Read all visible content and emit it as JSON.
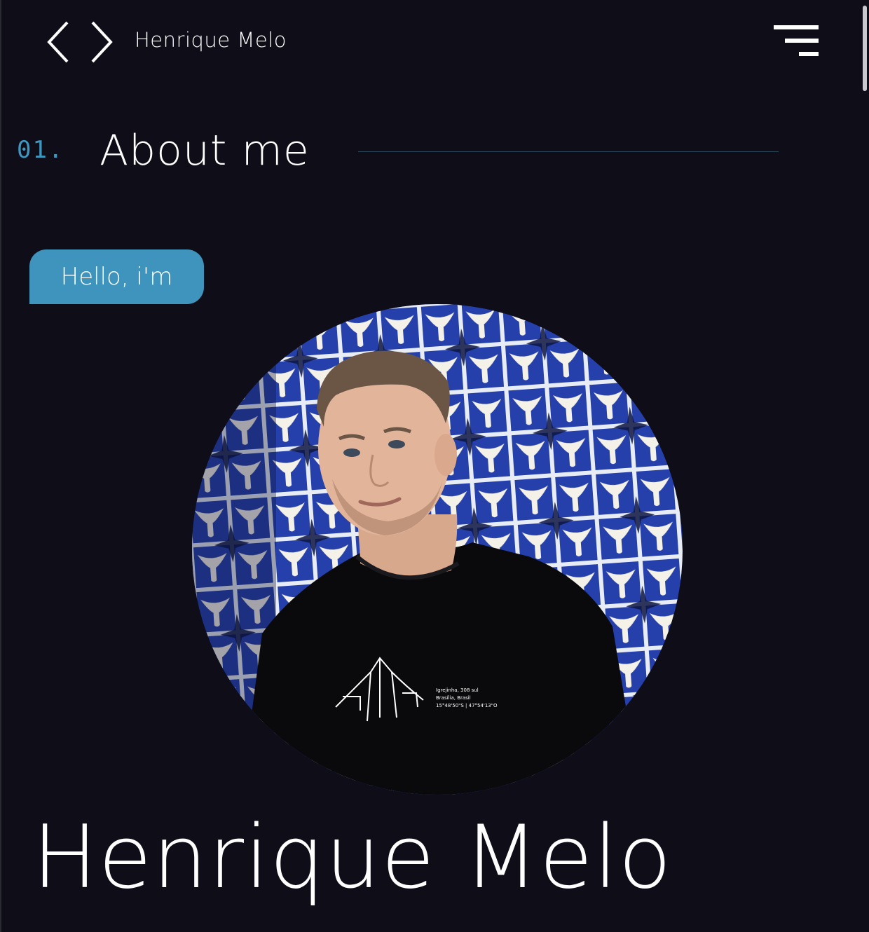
{
  "header": {
    "brand_name": "Henrique Melo",
    "back_icon": "chevron-left-icon",
    "forward_icon": "chevron-right-icon",
    "menu_icon": "hamburger-menu-icon"
  },
  "section": {
    "number": "01.",
    "title": "About me"
  },
  "greeting": {
    "label": "Hello, i'm"
  },
  "portrait": {
    "alt": "Portrait photo",
    "shirt_print": [
      "Igrejinha, 308 sul",
      "Brasília, Brasil",
      "15°48'50\"S | 47°54'13\"O"
    ]
  },
  "hero": {
    "name": "Henrique Melo"
  },
  "colors": {
    "background": "#0e0d18",
    "accent": "#3f94bd",
    "text": "#ffffff"
  }
}
